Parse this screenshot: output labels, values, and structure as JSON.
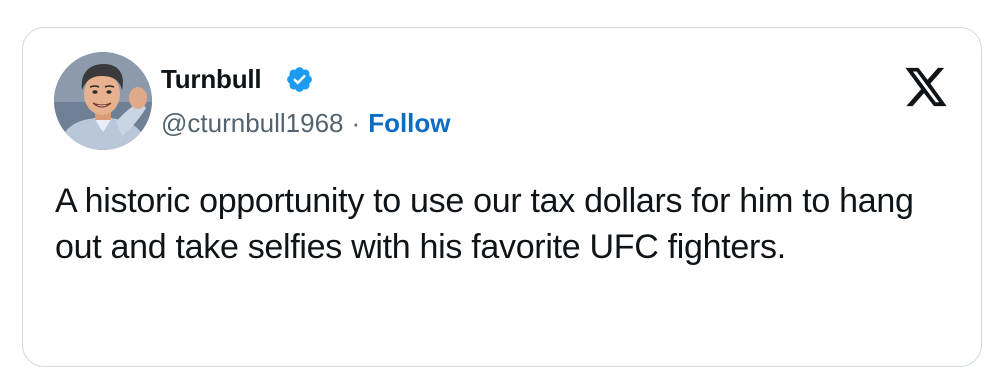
{
  "tweet": {
    "author": {
      "display_name": "Turnbull",
      "handle": "@cturnbull1968",
      "verified": true,
      "avatar_icon": "caricature-avatar-icon"
    },
    "separator": "·",
    "follow_label": "Follow",
    "text": "A historic opportunity to use our tax dollars for him to hang out and take selfies with his favorite UFC fighters.",
    "platform_icon": "x-logo-icon"
  },
  "colors": {
    "verified_badge": "#1d9bf0",
    "follow_link": "#0b6ec4",
    "border": "#cfd9de",
    "text_primary": "#0f1419",
    "text_secondary": "#536471"
  }
}
